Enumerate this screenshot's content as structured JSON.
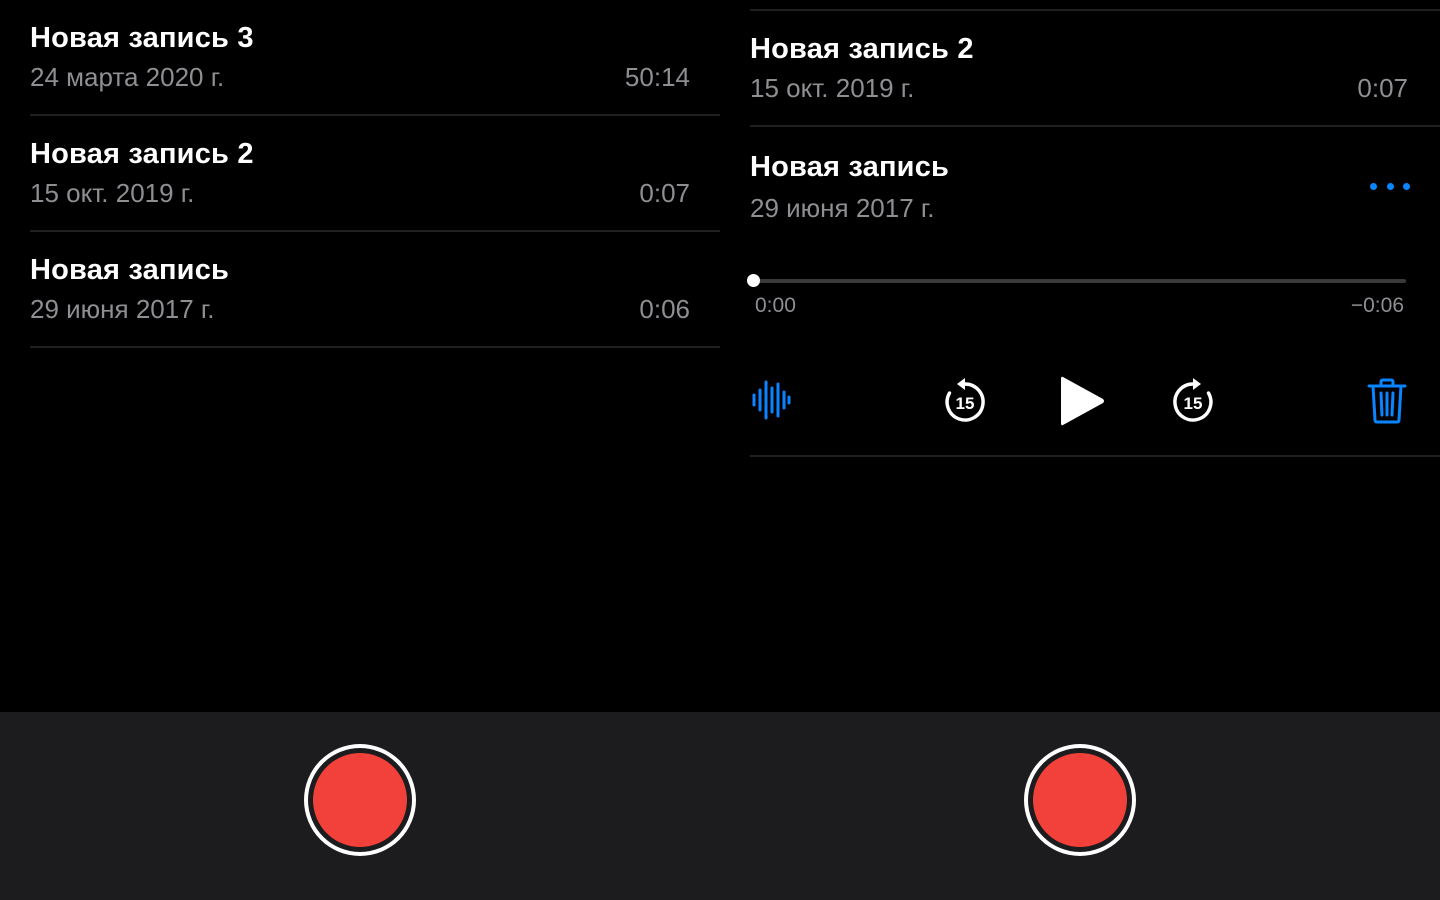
{
  "left_panel": {
    "recordings": [
      {
        "title": "Новая запись 3",
        "date": "24 марта 2020 г.",
        "duration": "50:14"
      },
      {
        "title": "Новая запись 2",
        "date": "15 окт. 2019 г.",
        "duration": "0:07"
      },
      {
        "title": "Новая запись",
        "date": "29 июня 2017 г.",
        "duration": "0:06"
      }
    ]
  },
  "right_panel": {
    "collapsed": {
      "title": "Новая запись 2",
      "date": "15 окт. 2019 г.",
      "duration": "0:07"
    },
    "expanded": {
      "title": "Новая запись",
      "date": "29 июня 2017 г.",
      "elapsed": "0:00",
      "remaining": "−0:06",
      "progress": 0.0,
      "skip_back_label": "15",
      "skip_forward_label": "15"
    }
  },
  "icons": {
    "more": "more-dots-icon",
    "waveform": "waveform-icon",
    "skip_back": "skip-back-15-icon",
    "play": "play-icon",
    "skip_forward": "skip-forward-15-icon",
    "trash": "trash-icon",
    "record": "record-icon"
  },
  "colors": {
    "background": "#000000",
    "bottom_bar": "#1c1c1e",
    "accent_blue": "#0a84ff",
    "record_red": "#f2413a",
    "secondary_text": "#8e8e93"
  }
}
